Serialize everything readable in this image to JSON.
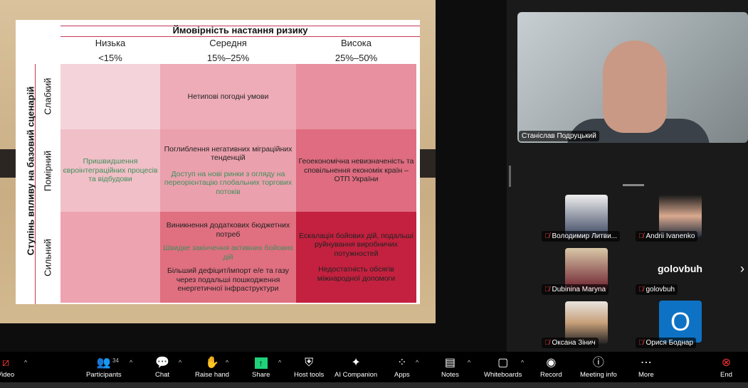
{
  "slide": {
    "title": "Ймовірність настання ризику",
    "columns": [
      {
        "label": "Низька",
        "range": "<15%"
      },
      {
        "label": "Середня",
        "range": "15%–25%"
      },
      {
        "label": "Висока",
        "range": "25%–50%"
      }
    ],
    "y_axis_label": "Ступінь впливу на базовий сценарій",
    "rows": [
      "Слабкий",
      "Помірний",
      "Сильний"
    ],
    "cells": {
      "r1c2": [
        "Нетипові погодні умови"
      ],
      "r2c1_green": "Пришвидшення євроінтеграційних процесів та відбудови",
      "r2c2": "Поглиблення негативних міграційних тенденцій",
      "r2c2_green": "Доступ на нові ринки з огляду на переорієнтацію глобальних торгових потоків",
      "r2c3": "Геоекономічна невизначеність та сповільнення економік країн – ОТП України",
      "r3c2a": "Виникнення додаткових бюджетних потреб",
      "r3c2_green": "Швидке закінчення активних бойових дій",
      "r3c2b": "Більший дефіцит/імпорт е/е та газу через подальші пошкодження енергетичної інфраструктури",
      "r3c3a": "Ескалація бойових дій, подальші руйнування виробничих потужностей",
      "r3c3b": "Недостатність обсягів міжнародної допомоги"
    },
    "colors": {
      "r1": [
        "#f5d3da",
        "#eeacb8",
        "#e8909f"
      ],
      "r2": [
        "#f1bfc8",
        "#eba0ad",
        "#df6c80"
      ],
      "r3": [
        "#eda3b0",
        "#e06f80",
        "#c3213f"
      ]
    }
  },
  "speaker": {
    "name": "Станіслав Подруцький"
  },
  "participants": [
    {
      "name": "Володимир Литви..."
    },
    {
      "name": "Andrii Ivanenko"
    },
    {
      "name": "Dubinina Maryna"
    },
    {
      "name": "golovbuh",
      "display": "golovbuh"
    },
    {
      "name": "Оксана Зінич"
    },
    {
      "name": "Орися Боднар",
      "initial": "О"
    }
  ],
  "toolbar": {
    "video": "Video",
    "participants": "Participants",
    "participants_count": "34",
    "chat": "Chat",
    "raise_hand": "Raise hand",
    "share": "Share",
    "host_tools": "Host tools",
    "ai": "AI Companion",
    "apps": "Apps",
    "notes": "Notes",
    "whiteboards": "Whiteboards",
    "record": "Record",
    "meeting_info": "Meeting info",
    "more": "More",
    "end": "End"
  }
}
